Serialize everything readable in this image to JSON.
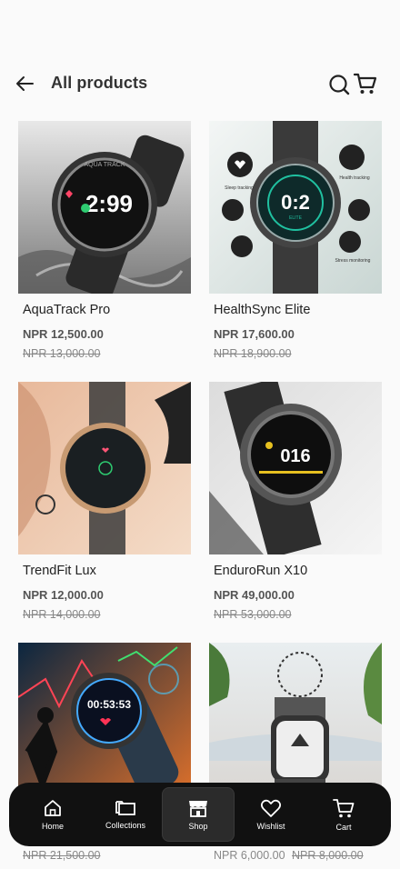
{
  "header": {
    "title": "All products",
    "back_icon": "arrow-left-icon",
    "search_icon": "search-icon",
    "cart_icon": "cart-icon"
  },
  "products": [
    {
      "name": "AquaTrack Pro",
      "price": "NPR 12,500.00",
      "old_price": "NPR 13,000.00"
    },
    {
      "name": "HealthSync Elite",
      "price": "NPR 17,600.00",
      "old_price": "NPR 18,900.00"
    },
    {
      "name": "TrendFit Lux",
      "price": "NPR 12,000.00",
      "old_price": "NPR 14,000.00"
    },
    {
      "name": "EnduroRun X10",
      "price": "NPR 49,000.00",
      "old_price": "NPR 53,000.00"
    },
    {
      "name": "",
      "price": "",
      "old_price": "NPR 21,500.00"
    },
    {
      "name": "",
      "price": "NPR 6,000.00",
      "old_price": "NPR 8,000.00"
    }
  ],
  "image_text": {
    "p1_time": "2:99",
    "p1_brand": "AQUA TRACK",
    "p2_time": "0:2",
    "p2_sub": "ELITE",
    "p2_sleep": "Sleep tracking",
    "p2_health": "Health tracking",
    "p2_stress": "Stress monitoring",
    "p4_time": "016",
    "p5_time": "00:53:53"
  },
  "nav": {
    "items": [
      {
        "label": "Home",
        "icon": "home-icon"
      },
      {
        "label": "Collections",
        "icon": "collections-icon"
      },
      {
        "label": "Shop",
        "icon": "shop-icon",
        "active": true
      },
      {
        "label": "Wishlist",
        "icon": "heart-icon"
      },
      {
        "label": "Cart",
        "icon": "cart-icon"
      }
    ]
  },
  "colors": {
    "nav_bg": "#111111",
    "text": "#222222",
    "muted": "#888888"
  }
}
